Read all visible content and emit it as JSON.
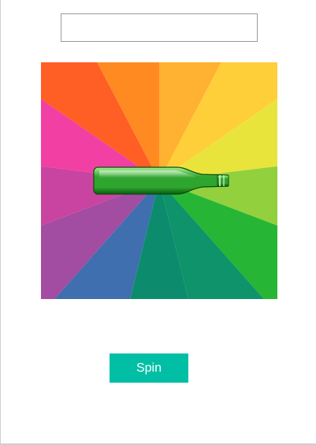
{
  "input": {
    "value": "",
    "placeholder": ""
  },
  "wheel": {
    "segment_colors": [
      "#FFB131",
      "#FFCF3A",
      "#E9E43C",
      "#92D13D",
      "#27B535",
      "#0E936A",
      "#0C8C6D",
      "#3F6FAF",
      "#A24CA2",
      "#C944A0",
      "#F23FA4",
      "#FF5E24",
      "#FF8A22"
    ]
  },
  "bottle": {
    "icon": "bottle-icon",
    "colors": {
      "glass": "#2ea52e",
      "glass_light": "#a8f095",
      "glass_dark": "#0d5a10"
    }
  },
  "spin_button": {
    "label": "Spin",
    "color": "#00BFA5"
  }
}
